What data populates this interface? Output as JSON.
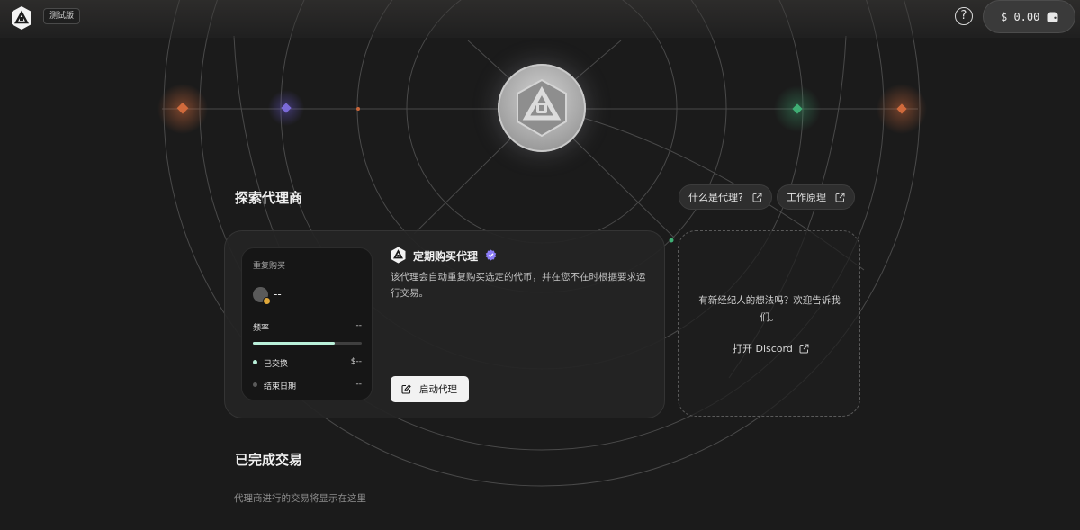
{
  "header": {
    "env_badge": "测试版",
    "help_label": "?",
    "balance": "$ 0.00"
  },
  "explore": {
    "title": "探索代理商",
    "links": [
      {
        "label": "什么是代理?"
      },
      {
        "label": "工作原理"
      }
    ]
  },
  "agent_card": {
    "preview": {
      "title": "重复购买",
      "token": "--",
      "frequency_label": "频率",
      "frequency_value": "--",
      "progress": 0.75,
      "swapped_label": "已交换",
      "swapped_value": "$--",
      "end_date_label": "结束日期",
      "end_date_value": "--"
    },
    "name": "定期购买代理",
    "description": "该代理会自动重复购买选定的代币，并在您不在时根据要求运行交易。",
    "start_button": "启动代理"
  },
  "idea_card": {
    "text": "有新经纪人的想法吗？欢迎告诉我们。",
    "link": "打开 Discord"
  },
  "completed": {
    "title": "已完成交易",
    "empty_text": "代理商进行的交易将显示在这里"
  },
  "colors": {
    "accent_mint": "#b9efd9",
    "verified_purple": "#8b7cf6",
    "coin_badge": "#e0a83a"
  }
}
